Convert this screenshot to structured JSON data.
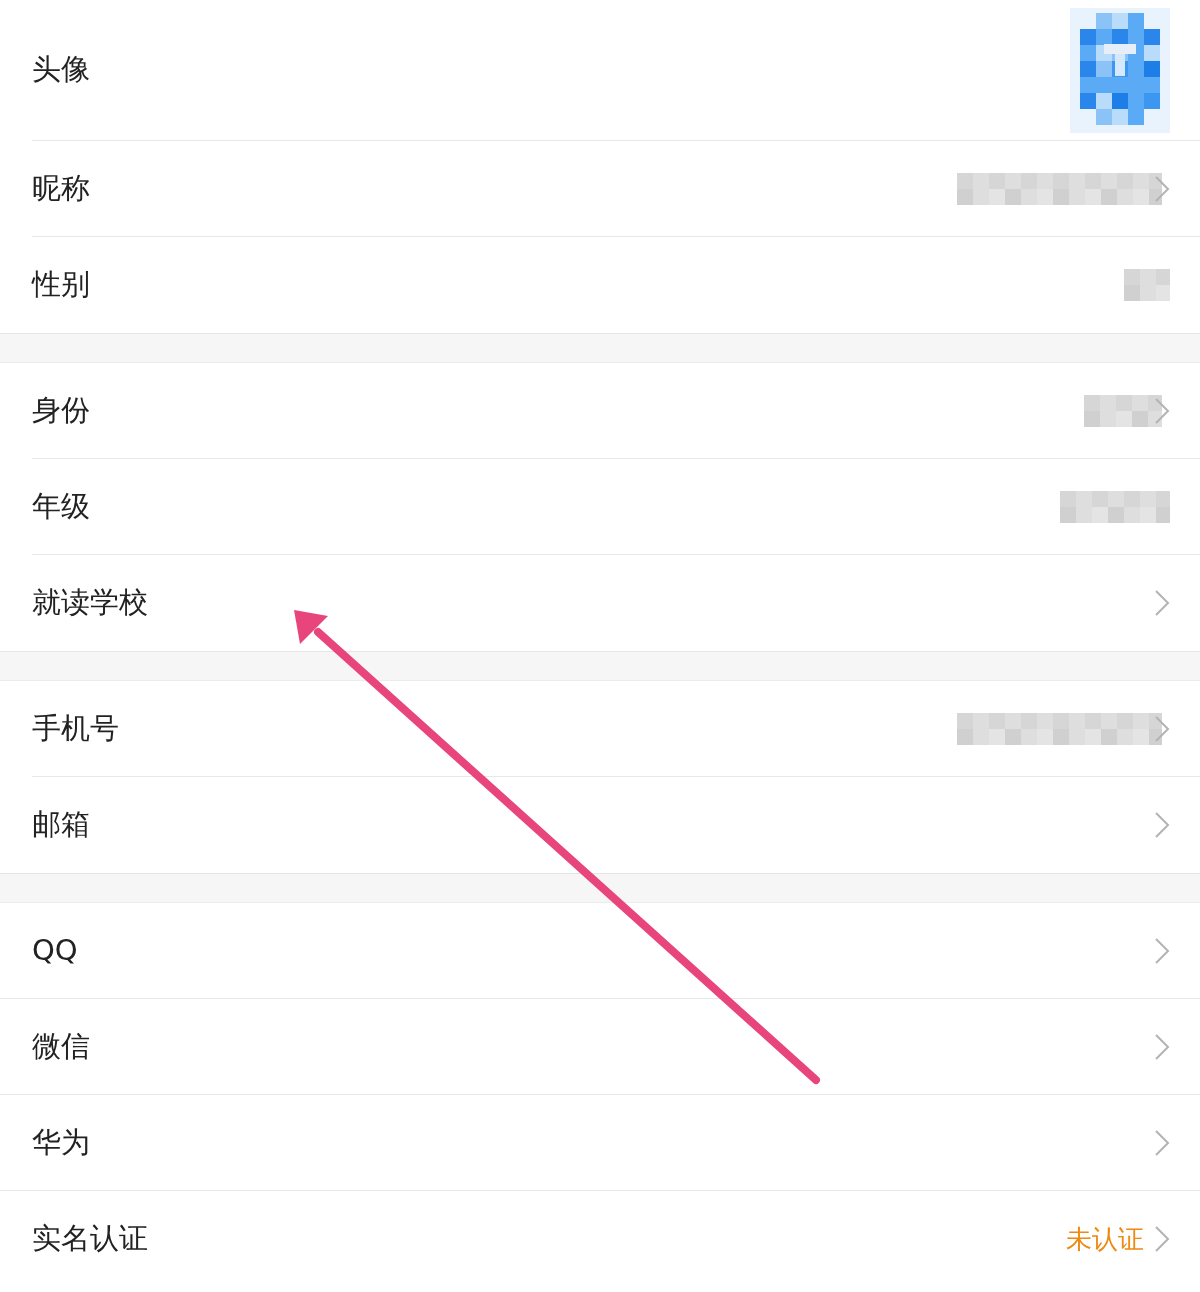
{
  "groups": [
    {
      "rows": [
        {
          "label": "头像",
          "kind": "avatar",
          "chevron": false
        },
        {
          "label": "昵称",
          "kind": "masked_long",
          "chevron": true
        },
        {
          "label": "性别",
          "kind": "masked_tiny",
          "chevron": false
        }
      ]
    },
    {
      "rows": [
        {
          "label": "身份",
          "kind": "masked_short",
          "chevron": true
        },
        {
          "label": "年级",
          "kind": "masked_medium",
          "chevron": false
        },
        {
          "label": "就读学校",
          "kind": "plain",
          "chevron": true
        }
      ]
    },
    {
      "rows": [
        {
          "label": "手机号",
          "kind": "masked_long",
          "chevron": true
        },
        {
          "label": "邮箱",
          "kind": "plain",
          "chevron": true
        }
      ]
    },
    {
      "rows": [
        {
          "label": "QQ",
          "kind": "plain",
          "chevron": true
        },
        {
          "label": "微信",
          "kind": "plain",
          "chevron": true
        },
        {
          "label": "华为",
          "kind": "plain",
          "chevron": true
        },
        {
          "label": "实名认证",
          "kind": "status",
          "status": "未认证",
          "chevron": true
        }
      ]
    }
  ]
}
